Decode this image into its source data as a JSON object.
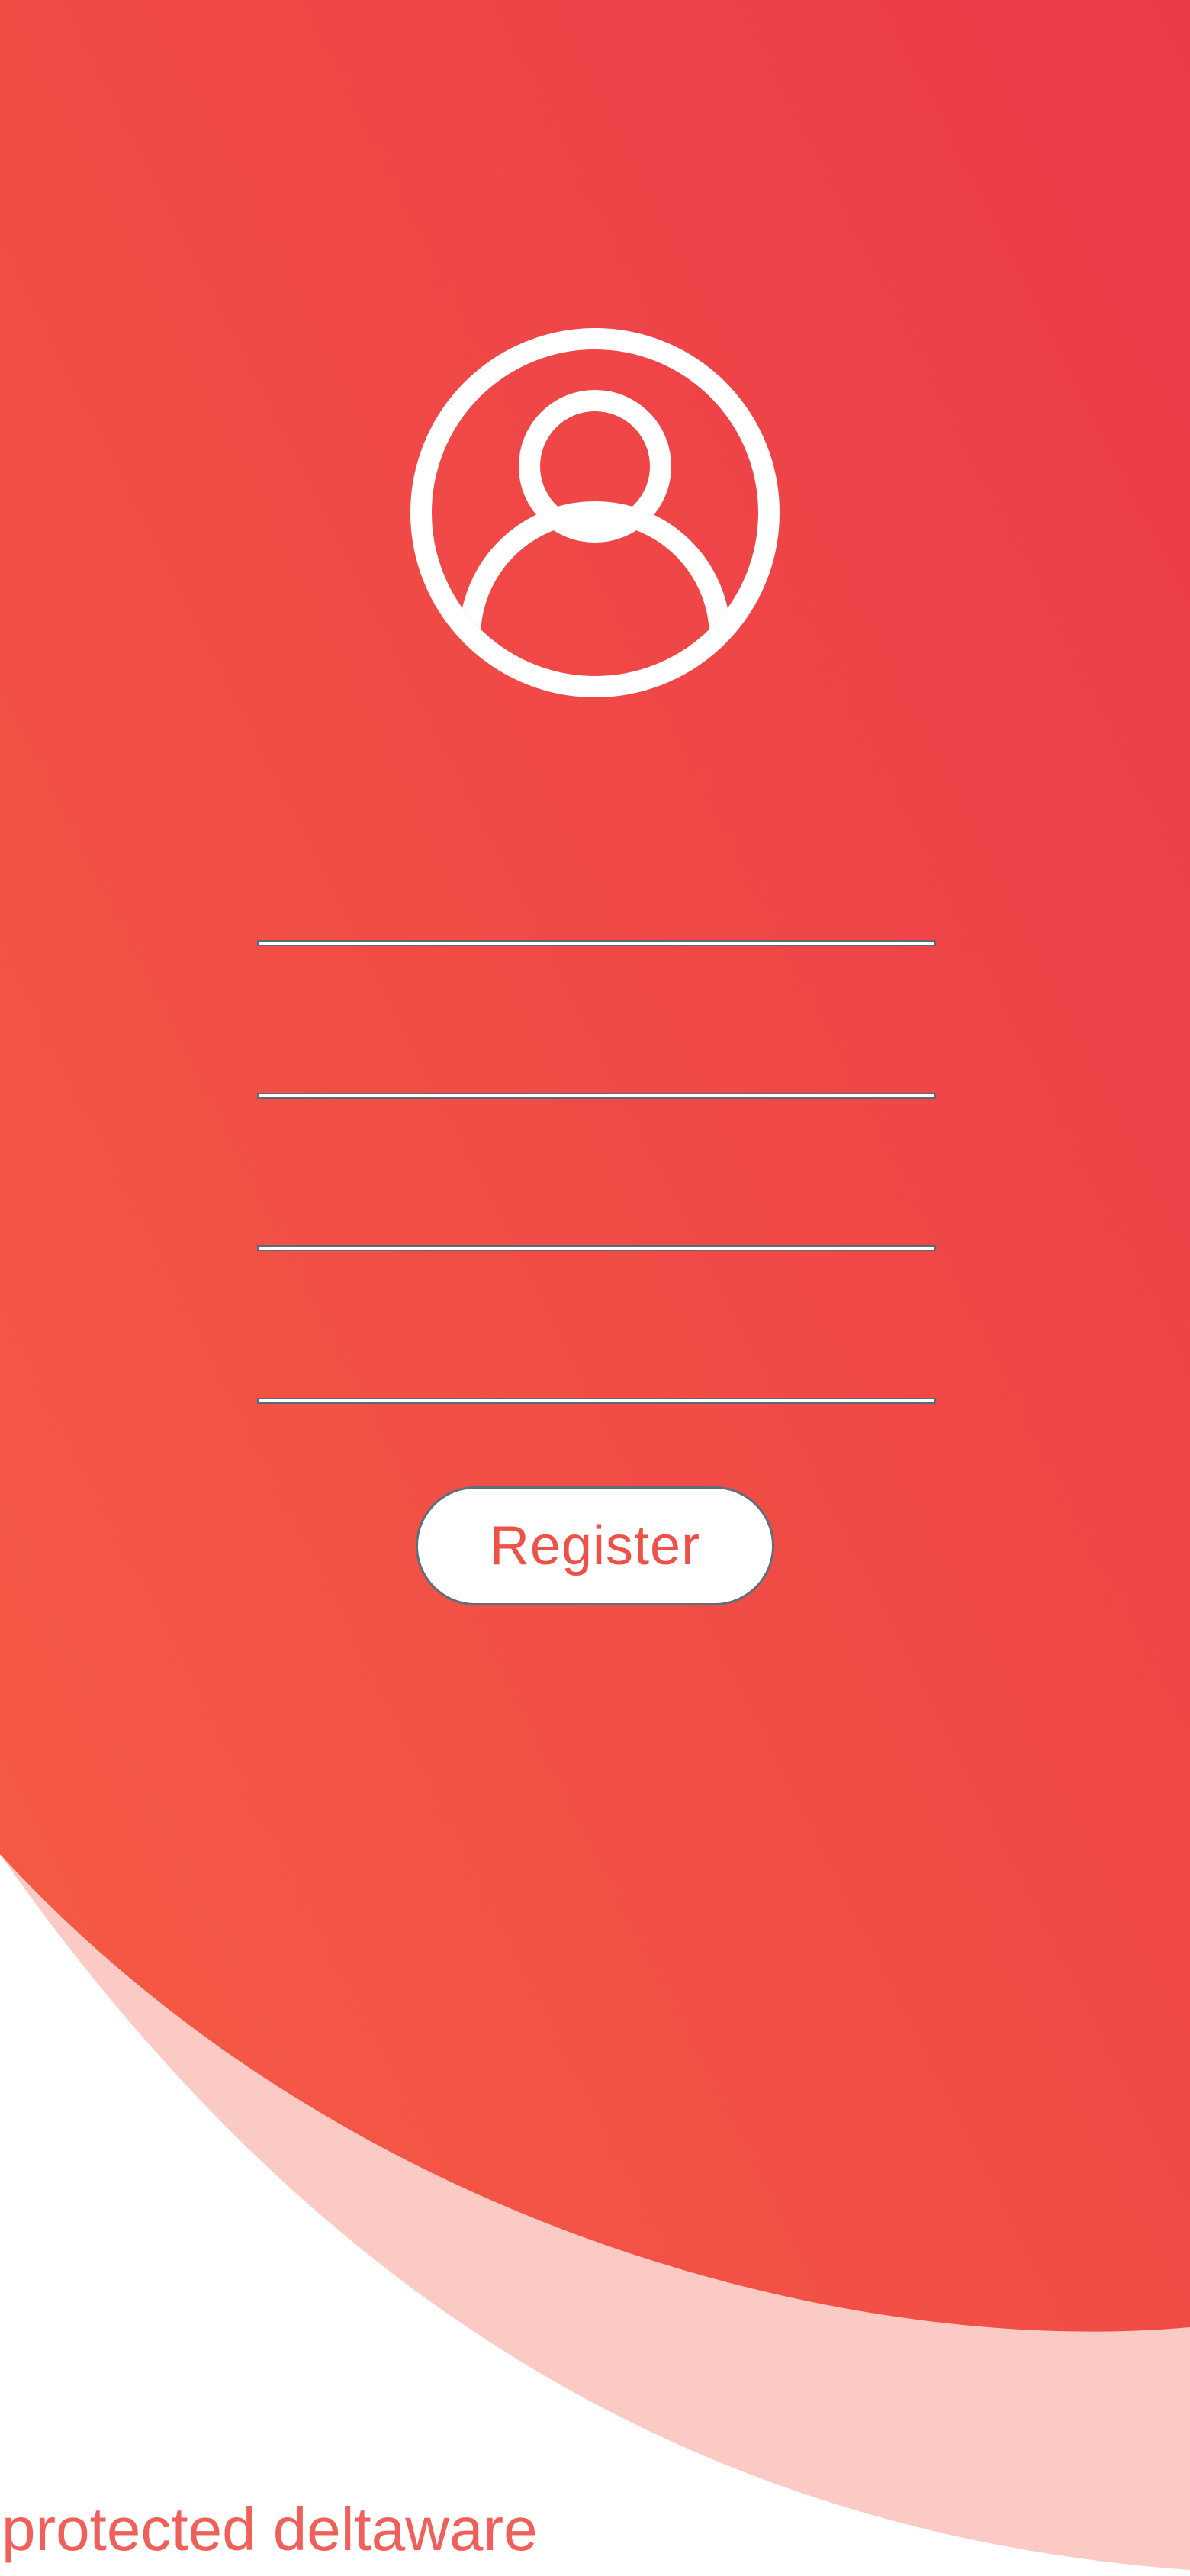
{
  "app": {
    "screen": "register"
  },
  "avatar": {
    "icon": "user-circle-icon"
  },
  "form": {
    "fields": [
      {
        "name": "username",
        "value": "",
        "placeholder": ""
      },
      {
        "name": "email",
        "value": "",
        "placeholder": ""
      },
      {
        "name": "password",
        "value": "",
        "placeholder": ""
      },
      {
        "name": "confirm-password",
        "value": "",
        "placeholder": ""
      }
    ],
    "register_label": "Register"
  },
  "footer": {
    "text": "protected deltaware"
  },
  "colors": {
    "gradient_top": "#ec3a49",
    "gradient_bottom": "#f45a45",
    "wave_light": "#fbcac4",
    "button_text": "#ef5148",
    "footer_text": "#f0605a",
    "background": "#ffffff"
  }
}
